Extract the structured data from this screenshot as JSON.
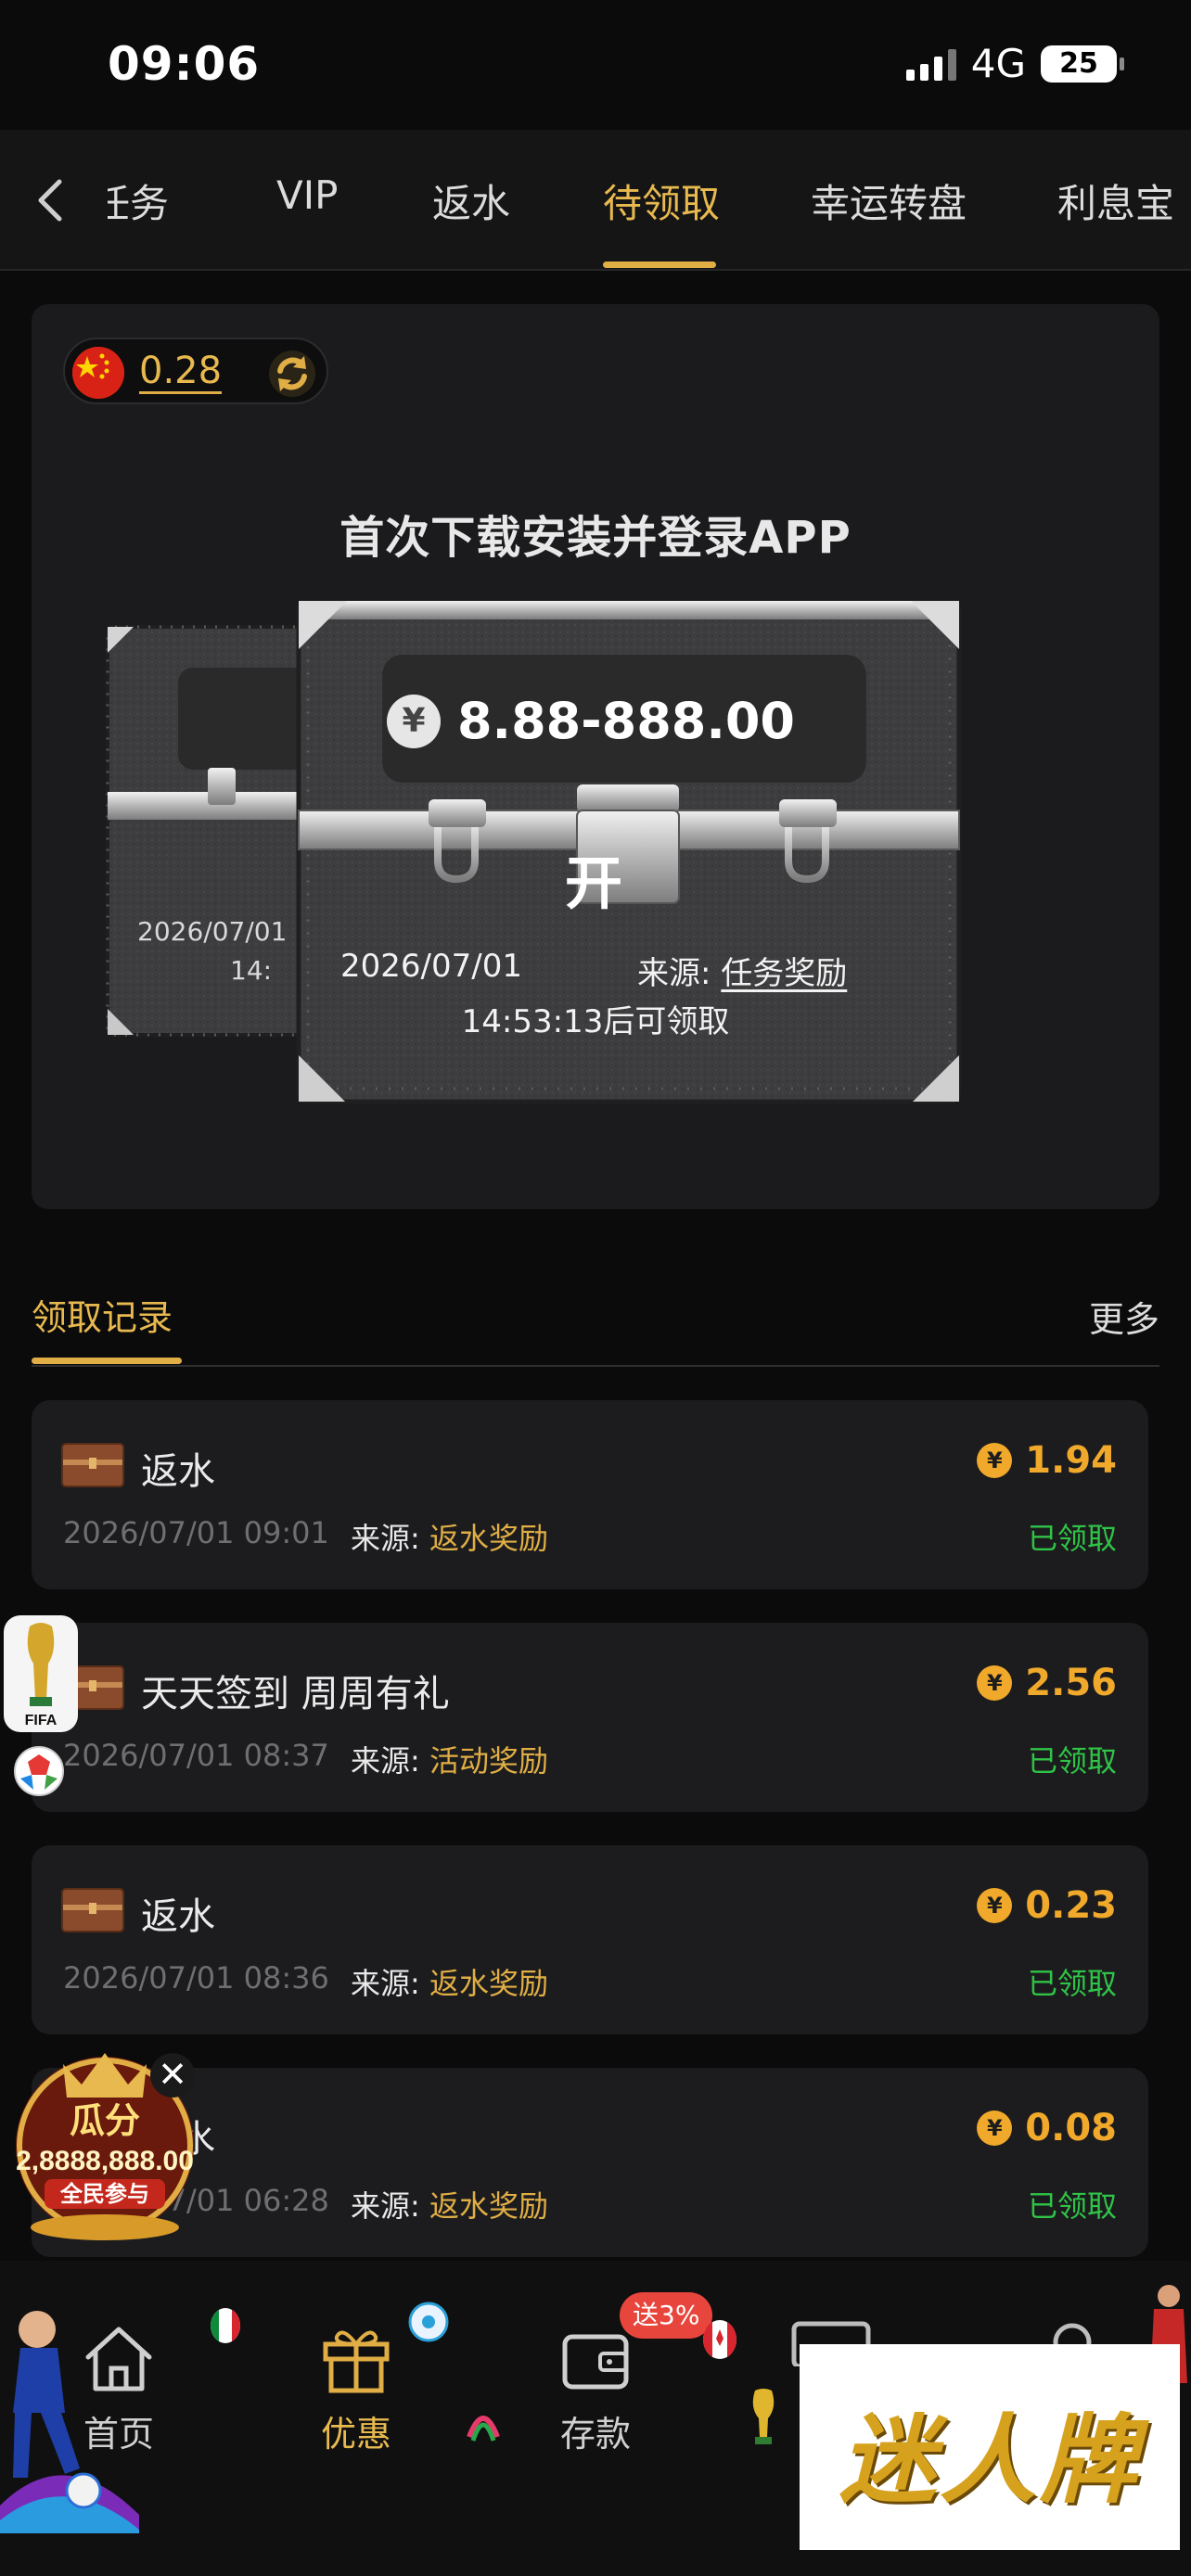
{
  "status_bar": {
    "time": "09:06",
    "network": "4G",
    "battery": "25"
  },
  "top_tabs": [
    {
      "label": "任务",
      "active": false
    },
    {
      "label": "VIP",
      "active": false
    },
    {
      "label": "返水",
      "active": false
    },
    {
      "label": "待领取",
      "active": true
    },
    {
      "label": "幸运转盘",
      "active": false
    },
    {
      "label": "利息宝",
      "active": false
    }
  ],
  "balance": {
    "value": "0.28"
  },
  "panel": {
    "title": "首次下载安装并登录APP",
    "amount": "8.88-888.00",
    "yen_symbol": "¥",
    "open_label": "开",
    "front_date": "2026/07/01",
    "source_label": "来源:",
    "source_value": "任务奖励",
    "countdown": "14:53:13后可领取",
    "back_date": "2026/07/01",
    "back_countdown": "14:"
  },
  "records_header": {
    "title": "领取记录",
    "more": "更多"
  },
  "records": [
    {
      "title": "返水",
      "amount": "1.94",
      "time": "2026/07/01 09:01",
      "source_label": "来源:",
      "source": "返水奖励",
      "status": "已领取"
    },
    {
      "title": "天天签到 周周有礼",
      "amount": "2.56",
      "time": "2026/07/01 08:37",
      "source_label": "来源:",
      "source": "活动奖励",
      "status": "已领取"
    },
    {
      "title": "返水",
      "amount": "0.23",
      "time": "2026/07/01 08:36",
      "source_label": "来源:",
      "source": "返水奖励",
      "status": "已领取"
    },
    {
      "title": "返水",
      "amount": "0.08",
      "time": "2026/07/01 06:28",
      "source_label": "来源:",
      "source": "返水奖励",
      "status": "已领取"
    }
  ],
  "floating": {
    "fifa_label": "FIFA",
    "promo_line1": "瓜分",
    "promo_line2": "2,8888,888.00",
    "promo_line3": "全民参与",
    "close": "✕"
  },
  "bottom_nav": [
    {
      "label": "首页",
      "icon": "home-icon",
      "active": false
    },
    {
      "label": "优惠",
      "icon": "gift-icon",
      "active": true
    },
    {
      "label": "存款",
      "icon": "wallet-icon",
      "active": false
    }
  ],
  "deposit_badge": "送3%",
  "brand": "迷人牌",
  "colors": {
    "gold": "#e0ae45",
    "amount": "#f0a92a",
    "success": "#2fc447",
    "badge": "#e8453c"
  }
}
